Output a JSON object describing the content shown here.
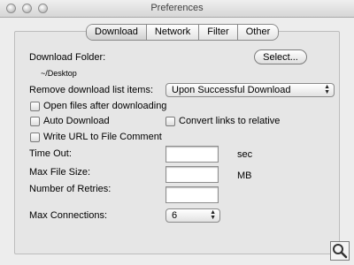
{
  "window": {
    "title": "Preferences"
  },
  "tabs": [
    {
      "label": "Download",
      "selected": true
    },
    {
      "label": "Network",
      "selected": false
    },
    {
      "label": "Filter",
      "selected": false
    },
    {
      "label": "Other",
      "selected": false
    }
  ],
  "download_folder": {
    "label": "Download Folder:",
    "path": "~/Desktop",
    "button_label": "Select..."
  },
  "remove_items": {
    "label": "Remove download list items:",
    "selected": "Upon Successful Download"
  },
  "checkboxes": {
    "open_files": {
      "label": "Open files after downloading",
      "checked": false
    },
    "auto_download": {
      "label": "Auto Download",
      "checked": false
    },
    "convert_links": {
      "label": "Convert links to relative",
      "checked": false
    },
    "write_url": {
      "label": "Write URL to File Comment",
      "checked": false
    }
  },
  "fields": {
    "time_out": {
      "label": "Time Out:",
      "value": "",
      "unit": "sec"
    },
    "max_file_size": {
      "label": "Max File Size:",
      "value": "",
      "unit": "MB"
    },
    "retries": {
      "label": "Number of Retries:",
      "value": ""
    }
  },
  "max_connections": {
    "label": "Max Connections:",
    "selected": "6"
  },
  "icons": {
    "zoom": "magnifier-icon"
  }
}
